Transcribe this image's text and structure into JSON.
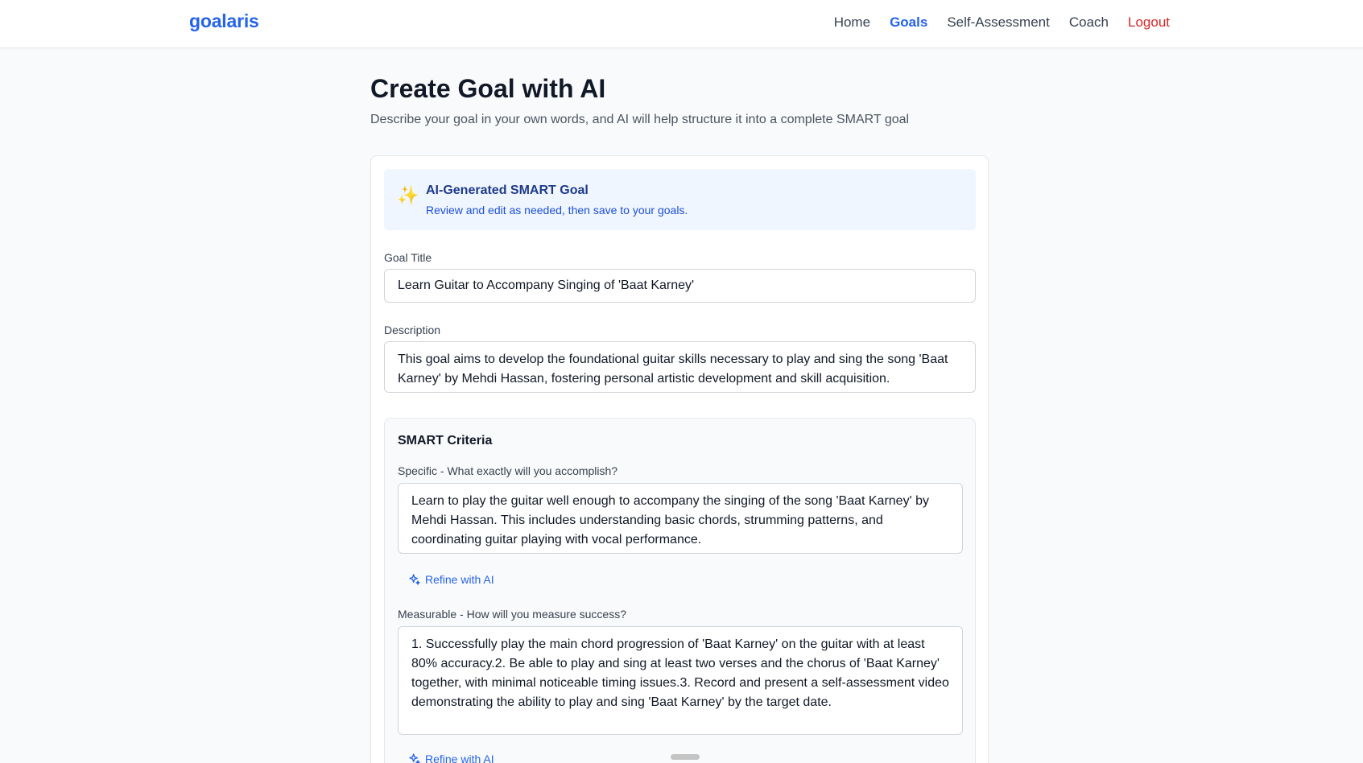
{
  "app": {
    "brand": "goalaris"
  },
  "nav": {
    "items": [
      {
        "label": "Home"
      },
      {
        "label": "Goals"
      },
      {
        "label": "Self-Assessment"
      },
      {
        "label": "Coach"
      },
      {
        "label": "Logout"
      }
    ],
    "active_item": "Goals",
    "colors": {
      "active": "#2563eb",
      "logout": "#dc2626"
    }
  },
  "page": {
    "title": "Create Goal with AI",
    "subtitle": "Describe your goal in your own words, and AI will help structure it into a complete SMART goal"
  },
  "ai_banner": {
    "icon": "sparkles-icon",
    "title": "AI-Generated SMART Goal",
    "subtitle": "Review and edit as needed, then save to your goals."
  },
  "form": {
    "goal_title": {
      "label": "Goal Title",
      "value": "Learn Guitar to Accompany Singing of 'Baat Karney'"
    },
    "description": {
      "label": "Description",
      "value": "This goal aims to develop the foundational guitar skills necessary to play and sing the song 'Baat Karney' by Mehdi Hassan, fostering personal artistic development and skill acquisition."
    },
    "smart": {
      "title": "SMART Criteria",
      "specific": {
        "label": "Specific - What exactly will you accomplish?",
        "value": "Learn to play the guitar well enough to accompany the singing of the song 'Baat Karney' by Mehdi Hassan. This includes understanding basic chords, strumming patterns, and coordinating guitar playing with vocal performance.",
        "refine_label": "Refine with AI"
      },
      "measurable": {
        "label": "Measurable - How will you measure success?",
        "value": "1. Successfully play the main chord progression of 'Baat Karney' on the guitar with at least 80% accuracy.2. Be able to play and sing at least two verses and the chorus of 'Baat Karney' together, with minimal noticeable timing issues.3. Record and present a self-assessment video demonstrating the ability to play and sing 'Baat Karney' by the target date.",
        "refine_label": "Refine with AI"
      }
    }
  }
}
